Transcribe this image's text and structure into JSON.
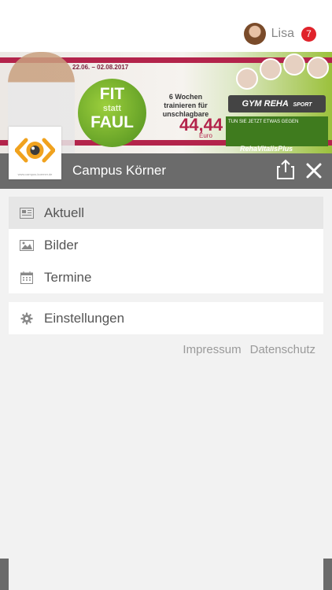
{
  "user": {
    "name": "Lisa",
    "notifications": "7"
  },
  "banner": {
    "dates": "22.06. – 02.08.2017",
    "stripe_text": "++ FERIENAKTION ++ FERIENAKTION ++ FERIENAKTION ++ FERIENAKTION ++",
    "fit_line1": "FIT",
    "fit_line2": "statt",
    "fit_line3": "FAUL",
    "offer_text": "6 Wochen trainieren für unschlagbare",
    "price": "44,44",
    "currency": "Euro",
    "brand": "GYM REHA",
    "brand_sub": "SPORT",
    "tagline": "TUN SIE JETZT ETWAS GEGEN",
    "footer_brand": "RehaVitalisPlus"
  },
  "campus": {
    "title": "Campus Körner",
    "logo_caption": "www.campus-koerner.de"
  },
  "menu": {
    "items": [
      {
        "label": "Aktuell",
        "icon": "newspaper-icon",
        "active": true
      },
      {
        "label": "Bilder",
        "icon": "image-icon",
        "active": false
      },
      {
        "label": "Termine",
        "icon": "calendar-icon",
        "active": false
      }
    ],
    "settings": {
      "label": "Einstellungen",
      "icon": "gear-icon"
    }
  },
  "footer": {
    "impressum": "Impressum",
    "datenschutz": "Datenschutz"
  },
  "colors": {
    "accent_bar": "#6b6b6b",
    "badge": "#e0232b",
    "brand_green": "#4f8f1f",
    "brand_red": "#b3244b"
  }
}
